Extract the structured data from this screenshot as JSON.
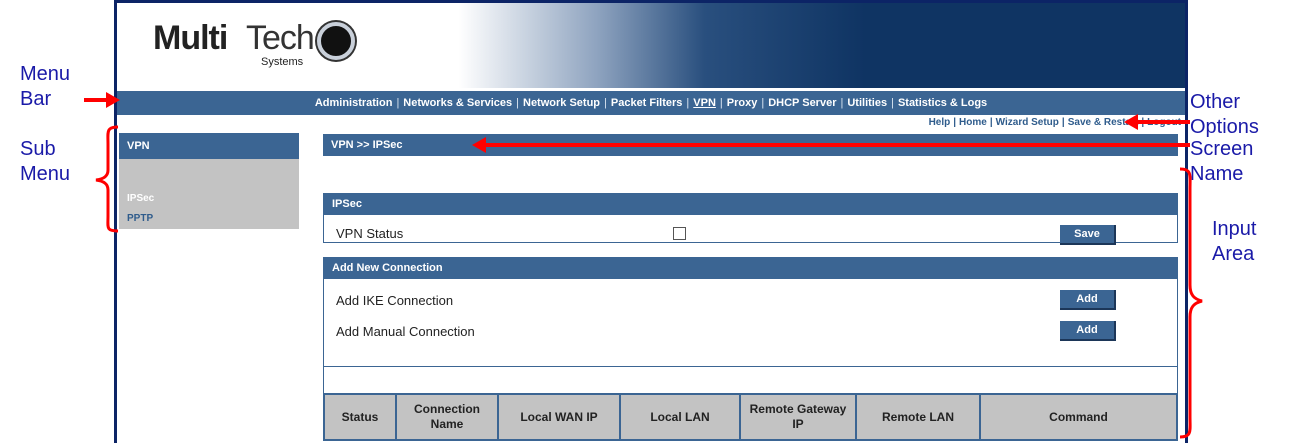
{
  "annotations": {
    "menu_bar": [
      "Menu",
      "Bar"
    ],
    "sub_menu": [
      "Sub",
      "Menu"
    ],
    "other_options": [
      "Other",
      "Options"
    ],
    "screen_name": [
      "Screen",
      "Name"
    ],
    "input_area": [
      "Input",
      "Area"
    ]
  },
  "logo": {
    "multi": "Multi",
    "tech": "Tech",
    "systems": "Systems"
  },
  "menubar": {
    "items": [
      "Administration",
      "Networks & Services",
      "Network Setup",
      "Packet Filters",
      "VPN",
      "Proxy",
      "DHCP Server",
      "Utilities",
      "Statistics & Logs"
    ],
    "active": "VPN",
    "separator": "|"
  },
  "options": {
    "items": [
      "Help",
      "Home",
      "Wizard Setup",
      "Save & Restart",
      "Logout"
    ]
  },
  "submenu": {
    "title": "VPN",
    "items": [
      "IPSec",
      "PPTP"
    ]
  },
  "breadcrumb": "VPN >> IPSec",
  "ipsec_panel": {
    "title": "IPSec",
    "vpn_status_label": "VPN Status",
    "vpn_status_checked": false,
    "save_label": "Save"
  },
  "add_panel": {
    "title": "Add New Connection",
    "ike_label": "Add IKE Connection",
    "manual_label": "Add Manual Connection",
    "add_label": "Add"
  },
  "table": {
    "headers": [
      "Status",
      "Connection Name",
      "Local WAN IP",
      "Local LAN",
      "Remote Gateway IP",
      "Remote LAN",
      "Command"
    ]
  },
  "colors": {
    "accent": "#3b6593",
    "annotation_text": "#1a1aa8",
    "annotation_arrow": "#ff0000"
  }
}
